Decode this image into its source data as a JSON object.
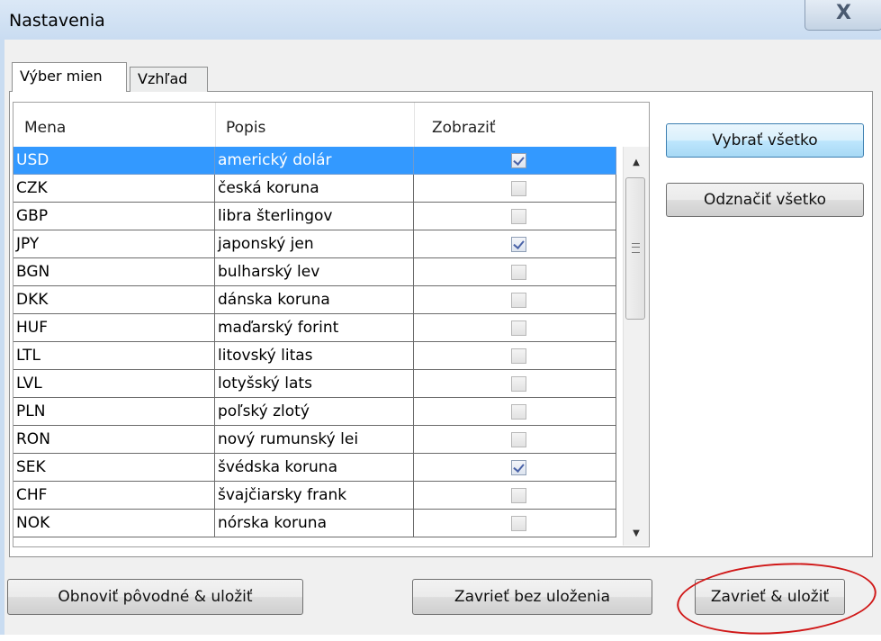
{
  "window": {
    "title": "Nastavenia",
    "close_label": "X"
  },
  "tabs": [
    {
      "label": "Výber mien",
      "active": true
    },
    {
      "label": "Vzhľad",
      "active": false
    }
  ],
  "table": {
    "columns": [
      "Mena",
      "Popis",
      "Zobraziť"
    ],
    "rows": [
      {
        "code": "USD",
        "name": "americký dolár",
        "show": true,
        "selected": true
      },
      {
        "code": "CZK",
        "name": "česká koruna",
        "show": false
      },
      {
        "code": "GBP",
        "name": "libra šterlingov",
        "show": false
      },
      {
        "code": "JPY",
        "name": "japonský jen",
        "show": true
      },
      {
        "code": "BGN",
        "name": "bulharský lev",
        "show": false
      },
      {
        "code": "DKK",
        "name": "dánska koruna",
        "show": false
      },
      {
        "code": "HUF",
        "name": "maďarský forint",
        "show": false
      },
      {
        "code": "LTL",
        "name": "litovský litas",
        "show": false
      },
      {
        "code": "LVL",
        "name": "lotyšský lats",
        "show": false
      },
      {
        "code": "PLN",
        "name": "poľský zlotý",
        "show": false
      },
      {
        "code": "RON",
        "name": "nový rumunský lei",
        "show": false
      },
      {
        "code": "SEK",
        "name": "švédska koruna",
        "show": true
      },
      {
        "code": "CHF",
        "name": "švajčiarsky frank",
        "show": false
      },
      {
        "code": "NOK",
        "name": "nórska koruna",
        "show": false
      }
    ]
  },
  "side_buttons": {
    "select_all": "Vybrať všetko",
    "deselect_all": "Odznačiť všetko"
  },
  "bottom_buttons": {
    "restore_save": "Obnoviť pôvodné & uložiť",
    "close_no_save": "Zavrieť bez uloženia",
    "close_save": "Zavrieť & uložiť"
  },
  "colors": {
    "selection": "#3399ff",
    "highlight_ellipse": "#d01818",
    "titlebar": "#c9dcf1"
  }
}
